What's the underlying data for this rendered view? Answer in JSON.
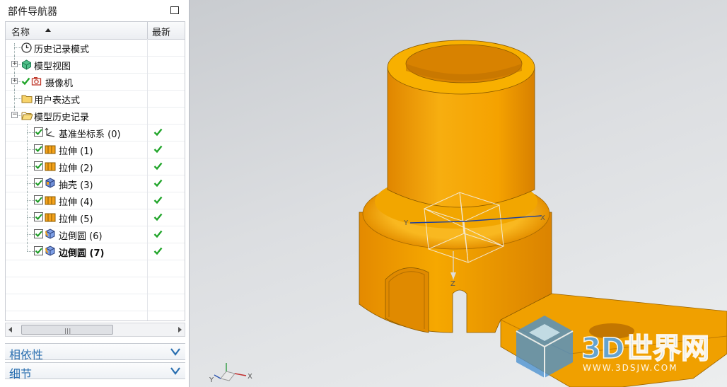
{
  "navigator": {
    "title": "部件导航器",
    "columns": {
      "name": "名称",
      "latest": "最新"
    },
    "items": [
      {
        "label": "历史记录模式",
        "icon": "clock-icon",
        "expander": "",
        "latest": false
      },
      {
        "label": "模型视图",
        "icon": "model-view-icon",
        "expander": "+",
        "latest": false
      },
      {
        "label": "摄像机",
        "icon": "camera-icon",
        "expander": "+",
        "latest": false
      },
      {
        "label": "用户表达式",
        "icon": "folder-icon",
        "expander": "",
        "latest": false
      },
      {
        "label": "模型历史记录",
        "icon": "folder-open-icon",
        "expander": "−",
        "latest": false
      },
      {
        "label": "基准坐标系 (0)",
        "icon": "datum-csys-icon",
        "checked": true,
        "latest": true
      },
      {
        "label": "拉伸 (1)",
        "icon": "extrude-icon",
        "checked": true,
        "latest": true
      },
      {
        "label": "拉伸 (2)",
        "icon": "extrude-icon",
        "checked": true,
        "latest": true
      },
      {
        "label": "抽壳 (3)",
        "icon": "shell-icon",
        "checked": true,
        "latest": true
      },
      {
        "label": "拉伸 (4)",
        "icon": "extrude-icon",
        "checked": true,
        "latest": true
      },
      {
        "label": "拉伸 (5)",
        "icon": "extrude-icon",
        "checked": true,
        "latest": true
      },
      {
        "label": "边倒圆 (6)",
        "icon": "edge-blend-icon",
        "checked": true,
        "latest": true
      },
      {
        "label": "边倒圆 (7)",
        "icon": "edge-blend-icon",
        "checked": true,
        "latest": true,
        "bold": true
      }
    ],
    "sections": [
      {
        "label": "相依性"
      },
      {
        "label": "细节"
      }
    ]
  },
  "viewport": {
    "axis_labels": {
      "x": "X",
      "y": "Y",
      "z": "Z"
    },
    "triad_labels": {
      "x": "X",
      "y": "Y"
    },
    "watermark": {
      "logo": "3D世界网",
      "url": "WWW.3DSJW.COM"
    },
    "colors": {
      "part": "#F5A800",
      "part_dark": "#E08A00",
      "part_shadow": "#C77800",
      "background": "#DCDEE1"
    }
  }
}
